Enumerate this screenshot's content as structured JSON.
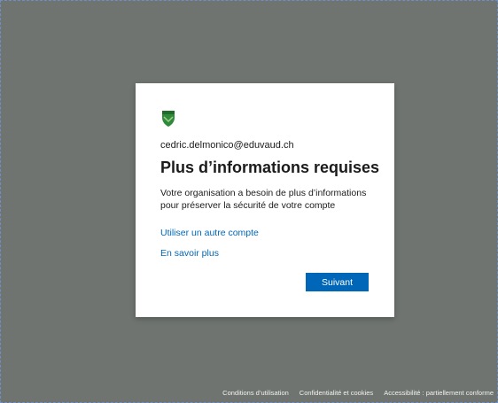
{
  "colors": {
    "background": "#6f7470",
    "card": "#ffffff",
    "accent": "#0067b8",
    "logo_green": "#2f8a3a"
  },
  "logo": {
    "icon": "shield-icon"
  },
  "card": {
    "email": "cedric.delmonico@eduvaud.ch",
    "title": "Plus d’informations requises",
    "description": "Votre organisation a besoin de plus d’informations pour préserver la sécurité de votre compte",
    "link_other_account": "Utiliser un autre compte",
    "link_learn_more": "En savoir plus",
    "next_button": "Suivant"
  },
  "footer": {
    "terms": "Conditions d’utilisation",
    "privacy": "Confidentialité et cookies",
    "accessibility": "Accessibilité : partiellement conforme"
  }
}
